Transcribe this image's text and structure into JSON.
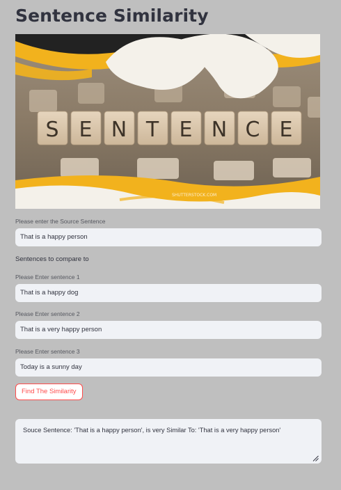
{
  "app": {
    "title": "Sentence Similarity"
  },
  "hero_image": {
    "letters": [
      "S",
      "E",
      "N",
      "T",
      "E",
      "N",
      "C",
      "E"
    ],
    "watermark": "SHUTTERSTOCK.COM",
    "alt": "sentence-image"
  },
  "source": {
    "label": "Please enter the Source Sentence",
    "value": "That is a happy person"
  },
  "compare_heading": "Sentences to compare to",
  "sentences": [
    {
      "label": "Please Enter sentence 1",
      "value": "That is a happy dog"
    },
    {
      "label": "Please Enter sentence 2",
      "value": "That is a very happy person"
    },
    {
      "label": "Please Enter sentence 3",
      "value": "Today is a sunny day"
    }
  ],
  "button": {
    "label": "Find The Similarity"
  },
  "result": {
    "text": "Souce Sentence: 'That is a happy person',  is very Similar To: 'That is a very happy person'"
  },
  "colors": {
    "background": "#bfbfbf",
    "input_bg": "#f0f2f6",
    "accent": "#ff4b4b",
    "text": "#31333f"
  },
  "icons": {
    "resize": "resize-handle-icon"
  }
}
